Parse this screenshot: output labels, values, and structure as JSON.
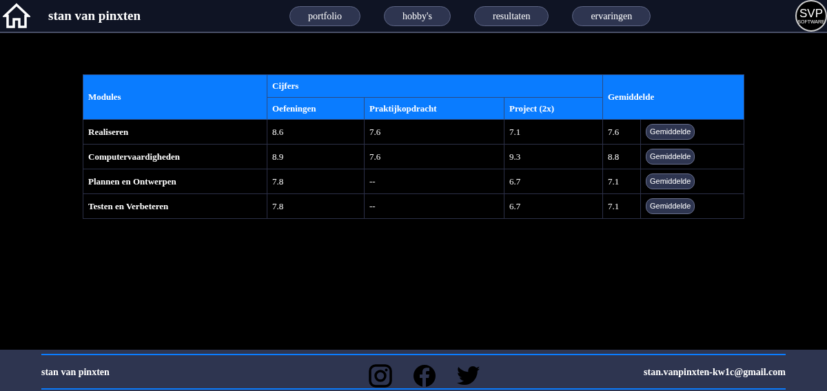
{
  "header": {
    "title": "stan van pinxten",
    "nav": [
      {
        "label": "portfolio"
      },
      {
        "label": "hobby's"
      },
      {
        "label": "resultaten"
      },
      {
        "label": "ervaringen"
      }
    ],
    "logo": {
      "main": "SVP",
      "sub": "SOFTWARE"
    }
  },
  "table": {
    "columns": {
      "modules": "Modules",
      "group": "Cijfers",
      "average": "Gemiddelde",
      "sub": [
        "Oefeningen",
        "Praktijkopdracht",
        "Project (2x)"
      ]
    },
    "rows": [
      {
        "module": "Realiseren",
        "grades": [
          "8.6",
          "7.6",
          "7.1"
        ],
        "average": "7.6",
        "button": "Gemiddelde"
      },
      {
        "module": "Computervaardigheden",
        "grades": [
          "8.9",
          "7.6",
          "9.3"
        ],
        "average": "8.8",
        "button": "Gemiddelde"
      },
      {
        "module": "Plannen en Ontwerpen",
        "grades": [
          "7.8",
          "--",
          "6.7"
        ],
        "average": "7.1",
        "button": "Gemiddelde"
      },
      {
        "module": "Testen en Verbeteren",
        "grades": [
          "7.8",
          "--",
          "6.7"
        ],
        "average": "7.1",
        "button": "Gemiddelde"
      }
    ]
  },
  "footer": {
    "name": "stan van pinxten",
    "email": "stan.vanpinxten-kw1c@gmail.com",
    "social": [
      {
        "kind": "instagram"
      },
      {
        "kind": "facebook"
      },
      {
        "kind": "twitter"
      }
    ]
  }
}
